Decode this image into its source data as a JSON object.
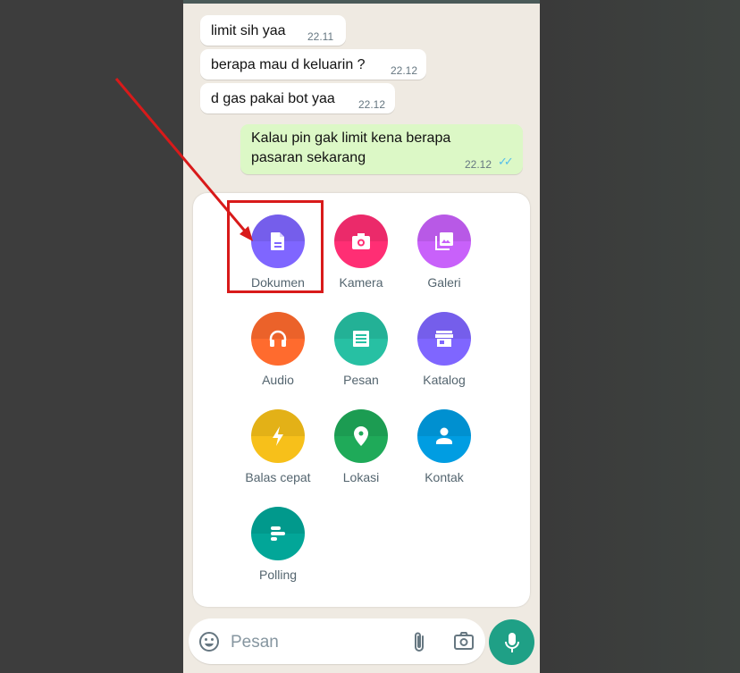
{
  "chat": {
    "messages": [
      {
        "direction": "incoming",
        "text": "limit sih yaa",
        "time": "22.11"
      },
      {
        "direction": "incoming",
        "text": "berapa mau d keluarin ?",
        "time": "22.12"
      },
      {
        "direction": "incoming",
        "text": "d gas pakai bot yaa",
        "time": "22.12"
      },
      {
        "direction": "outgoing",
        "text": "Kalau pin gak limit kena berapa pasaran sekarang",
        "time": "22.12",
        "status": "read"
      }
    ]
  },
  "attach_menu": {
    "items": [
      {
        "label": "Dokumen",
        "icon": "document-icon",
        "color": "#7f66ff"
      },
      {
        "label": "Kamera",
        "icon": "camera-icon",
        "color": "#ff2e74"
      },
      {
        "label": "Galeri",
        "icon": "gallery-icon",
        "color": "#c861fa"
      },
      {
        "label": "Audio",
        "icon": "headphones-icon",
        "color": "#ff6b2e"
      },
      {
        "label": "Pesan",
        "icon": "message-template-icon",
        "color": "#27c0a3"
      },
      {
        "label": "Katalog",
        "icon": "storefront-icon",
        "color": "#7f66ff"
      },
      {
        "label": "Balas cepat",
        "icon": "lightning-icon",
        "color": "#f7c01a"
      },
      {
        "label": "Lokasi",
        "icon": "location-pin-icon",
        "color": "#1faa59"
      },
      {
        "label": "Kontak",
        "icon": "contact-person-icon",
        "color": "#009de2"
      },
      {
        "label": "Polling",
        "icon": "poll-icon",
        "color": "#02a698"
      }
    ]
  },
  "composer": {
    "placeholder": "Pesan",
    "emoji_icon": "emoji-icon",
    "attach_icon": "paperclip-icon",
    "camera_icon": "camera-icon",
    "send_icon": "microphone-icon"
  },
  "annotation": {
    "highlight_target": "Dokumen",
    "color": "#d81a1a"
  }
}
